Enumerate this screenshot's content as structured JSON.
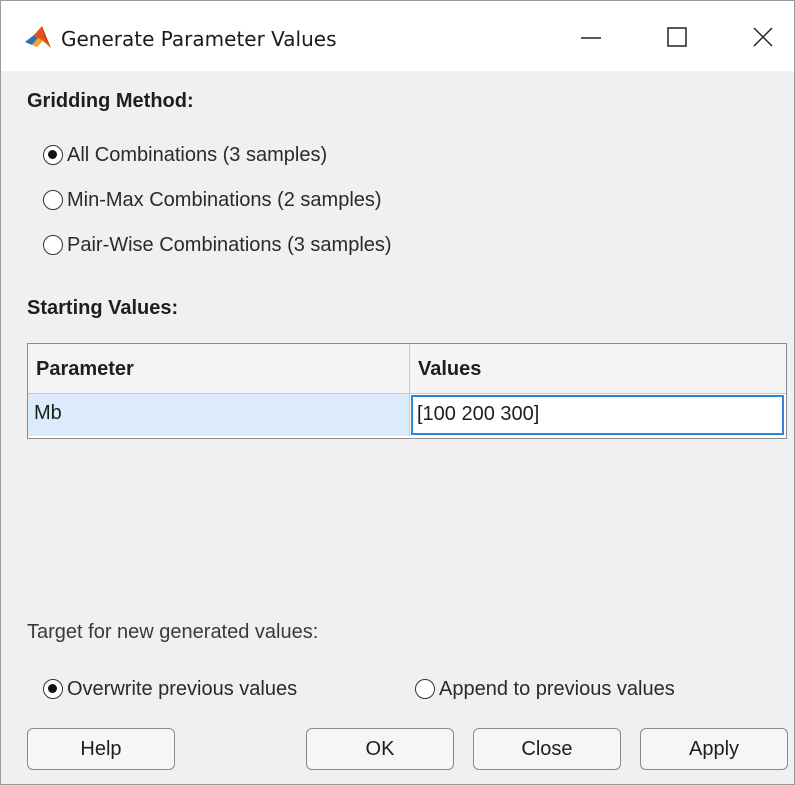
{
  "window": {
    "title": "Generate Parameter Values",
    "icon": "matlab-logo-icon",
    "controls": [
      "minimize-icon",
      "maximize-icon",
      "close-icon"
    ]
  },
  "gridding": {
    "heading": "Gridding Method:",
    "options": [
      {
        "label": "All Combinations (3 samples)",
        "checked": true
      },
      {
        "label": "Min-Max Combinations (2 samples)",
        "checked": false
      },
      {
        "label": "Pair-Wise Combinations (3 samples)",
        "checked": false
      }
    ]
  },
  "starting": {
    "heading": "Starting Values:",
    "columns": [
      "Parameter",
      "Values"
    ],
    "rows": [
      {
        "parameter": "Mb",
        "values": "[100 200 300]"
      }
    ]
  },
  "target": {
    "label": "Target for new generated values:",
    "options": [
      {
        "label": "Overwrite previous values",
        "checked": true
      },
      {
        "label": "Append to previous values",
        "checked": false
      }
    ]
  },
  "buttons": {
    "help": "Help",
    "ok": "OK",
    "close": "Close",
    "apply": "Apply"
  },
  "colors": {
    "selected_row": "#dcebfb",
    "edit_border": "#2e84d8",
    "dialog_bg": "#f0f0f0"
  }
}
